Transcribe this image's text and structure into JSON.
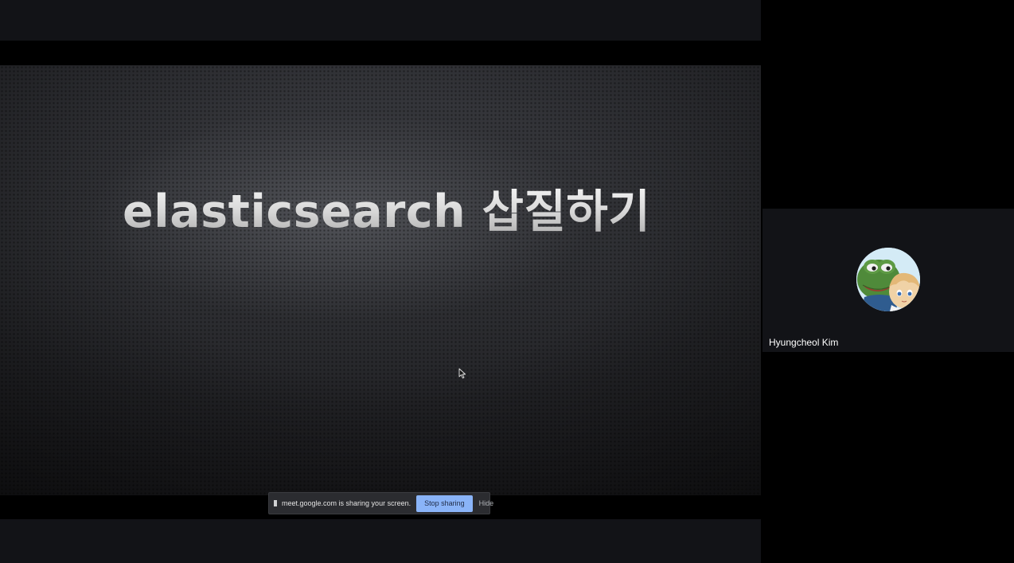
{
  "slide": {
    "title": "elasticsearch 삽질하기"
  },
  "share_bar": {
    "message": "meet.google.com is sharing your screen.",
    "stop_label": "Stop sharing",
    "hide_label": "Hide"
  },
  "participant": {
    "name": "Hyungcheol Kim",
    "avatar": "pepe-and-anime-character-avatar"
  },
  "icons": {
    "pause": "pause-icon",
    "cursor": "mouse-cursor-icon"
  }
}
